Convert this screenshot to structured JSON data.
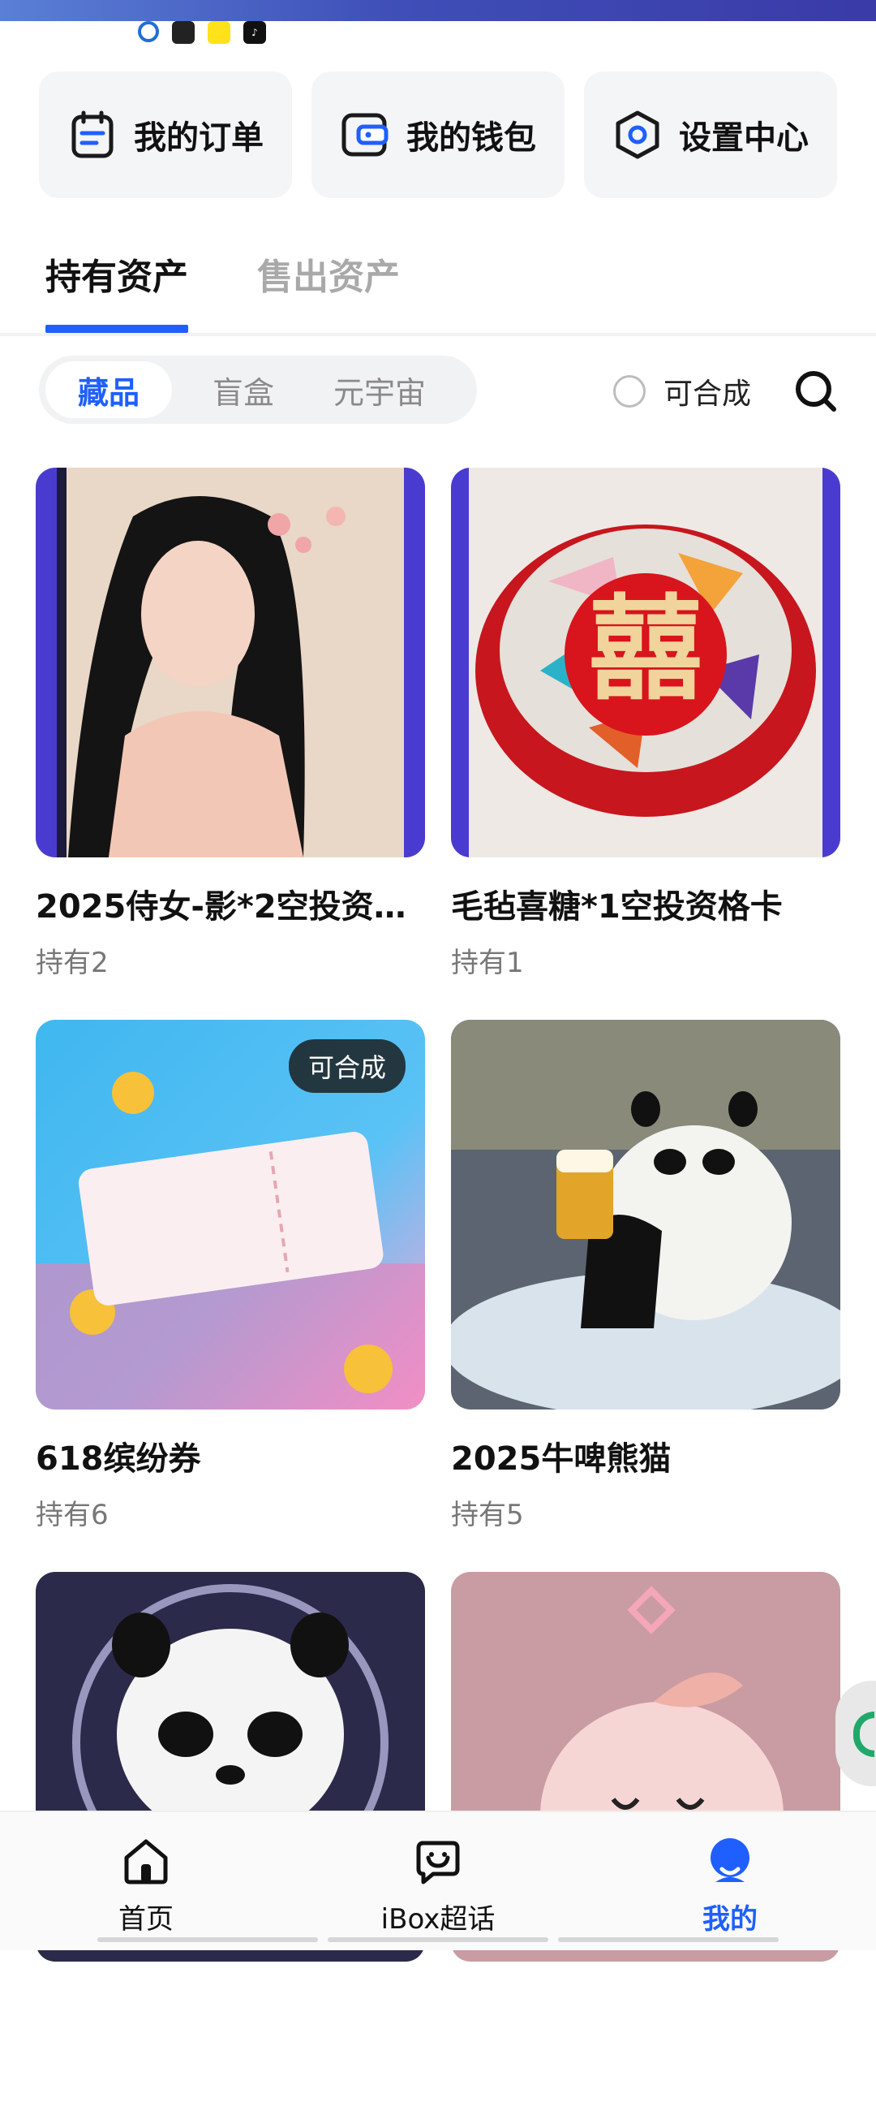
{
  "quick_actions": [
    {
      "label": "我的订单",
      "icon": "order-list-icon"
    },
    {
      "label": "我的钱包",
      "icon": "wallet-icon"
    },
    {
      "label": "设置中心",
      "icon": "settings-hex-icon"
    }
  ],
  "asset_tabs": [
    "持有资产",
    "售出资产"
  ],
  "filter_tabs": [
    "藏品",
    "盲盒",
    "元宇宙"
  ],
  "merge_filter_label": "可合成",
  "items": [
    {
      "name": "2025侍女-影*2空投资…",
      "hold": "持有2",
      "badge": ""
    },
    {
      "name": "毛毡喜糖*1空投资格卡",
      "hold": "持有1",
      "badge": ""
    },
    {
      "name": "618缤纷券",
      "hold": "持有6",
      "badge": "可合成"
    },
    {
      "name": "2025牛啤熊猫",
      "hold": "持有5",
      "badge": ""
    },
    {
      "name": "",
      "hold": "",
      "badge": ""
    },
    {
      "name": "",
      "hold": "",
      "badge": ""
    }
  ],
  "bottom_nav": [
    {
      "label": "首页",
      "icon": "home-icon"
    },
    {
      "label": "iBox超话",
      "icon": "chat-icon"
    },
    {
      "label": "我的",
      "icon": "profile-icon"
    }
  ],
  "colors": {
    "accent": "#1f5fff"
  }
}
